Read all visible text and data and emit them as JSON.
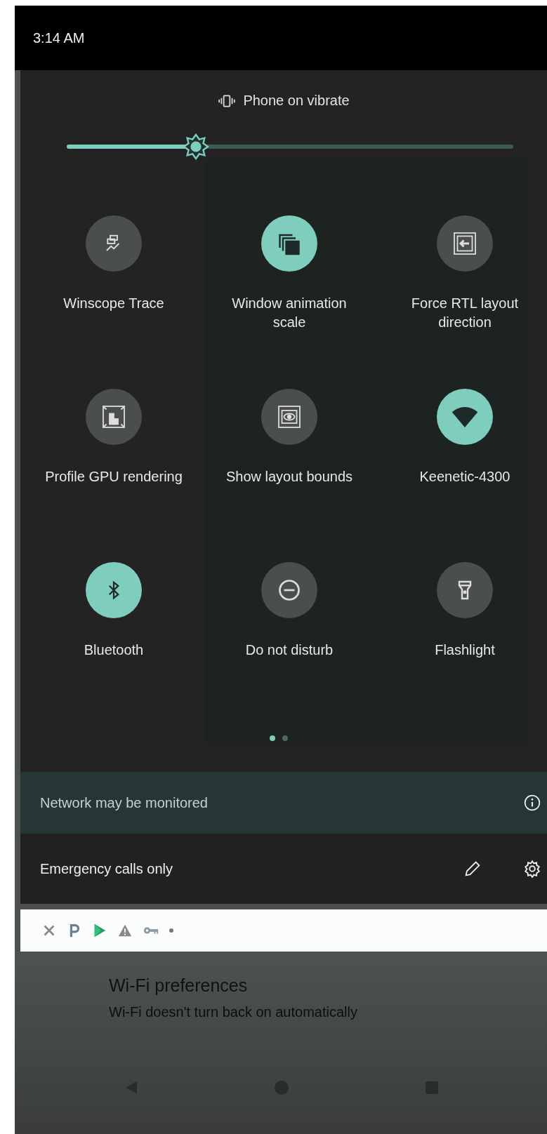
{
  "status_bar": {
    "time": "3:14 AM"
  },
  "quick_settings": {
    "ringer_status": "Phone on vibrate",
    "brightness": {
      "level": 0.29
    },
    "tiles": [
      {
        "kind": "winscope",
        "label": "Winscope Trace",
        "on": false
      },
      {
        "kind": "windows",
        "label": "Window animation scale",
        "on": true
      },
      {
        "kind": "rtl",
        "label": "Force RTL layout direction",
        "on": false
      },
      {
        "kind": "gpu",
        "label": "Profile GPU rendering",
        "on": false
      },
      {
        "kind": "bounds",
        "label": "Show layout bounds",
        "on": false
      },
      {
        "kind": "wifi",
        "label": "Keenetic-4300",
        "on": true
      },
      {
        "kind": "bluetooth",
        "label": "Bluetooth",
        "on": true
      },
      {
        "kind": "dnd",
        "label": "Do not disturb",
        "on": false
      },
      {
        "kind": "flashlight",
        "label": "Flashlight",
        "on": false
      }
    ],
    "pages": [
      {
        "selected": true
      },
      {
        "selected": false
      }
    ],
    "network_notice": "Network may be monitored",
    "carrier_text": "Emergency calls only"
  },
  "background_settings": {
    "title": "Wi-Fi preferences",
    "subtitle": "Wi-Fi doesn't turn back on automatically"
  }
}
